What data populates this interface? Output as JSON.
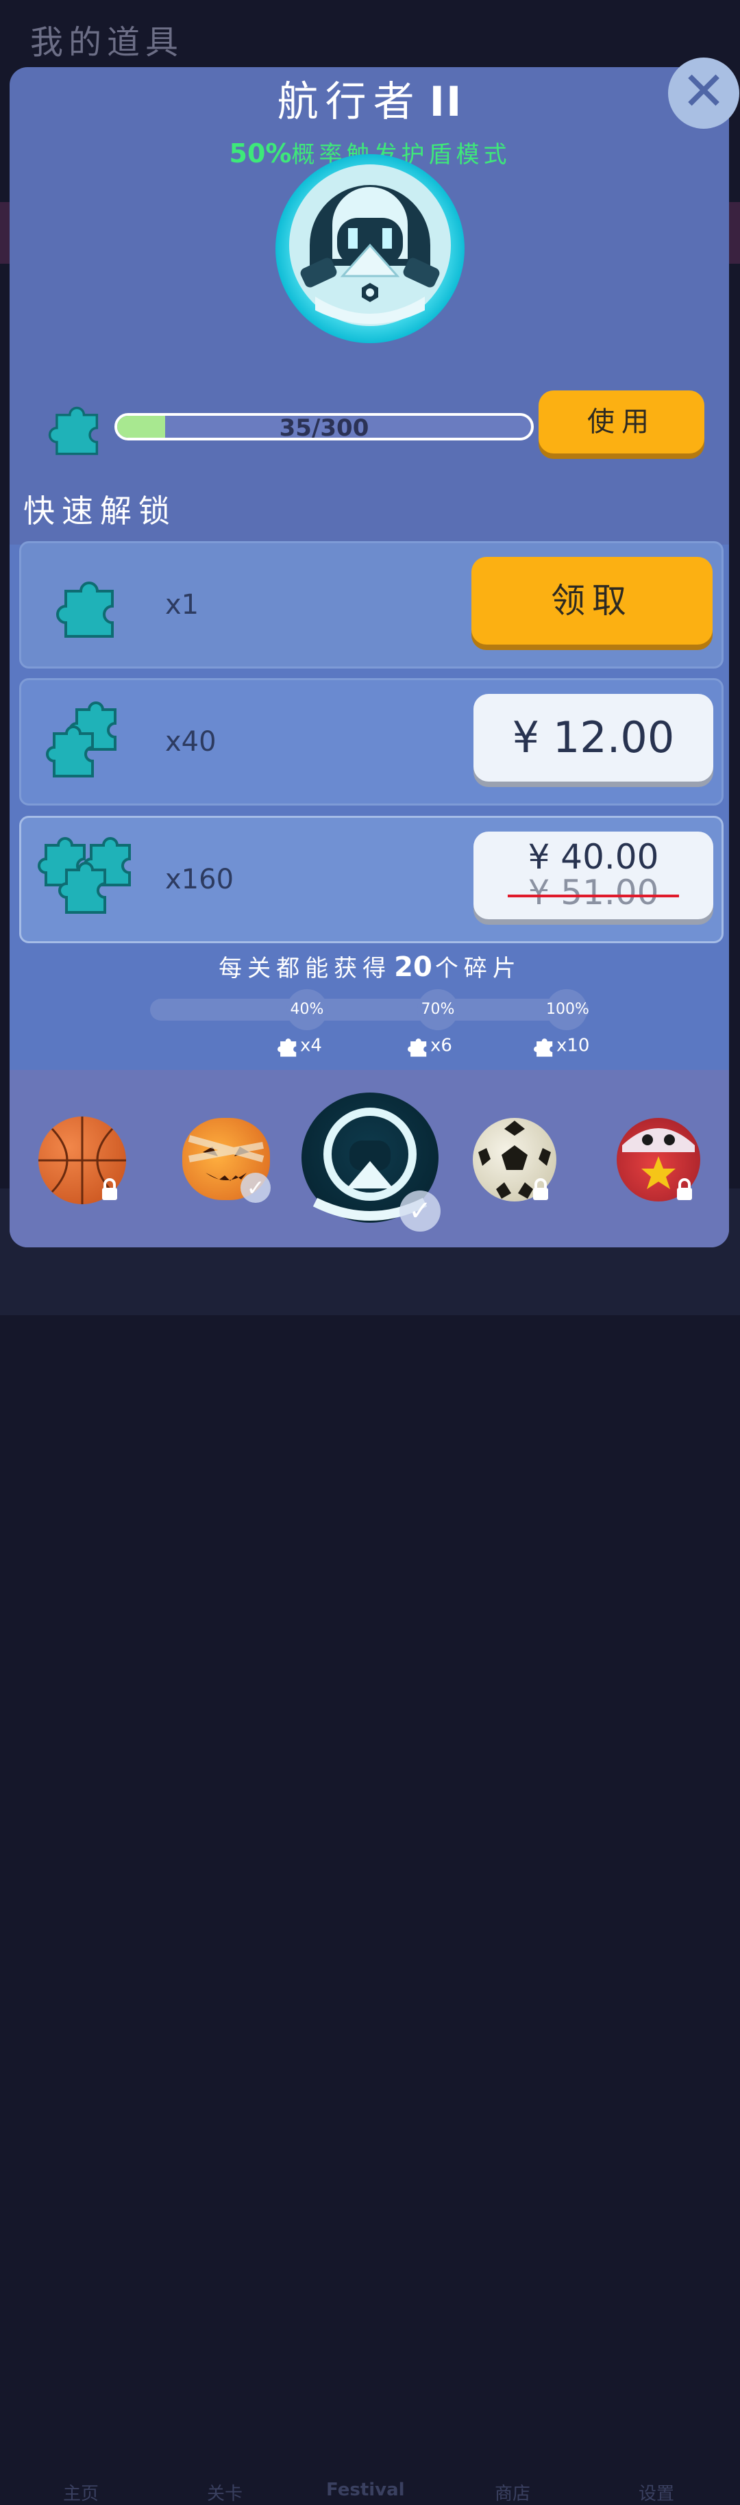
{
  "background": {
    "screen_title": "我的道具",
    "nav": [
      "主页",
      "关卡",
      "Festival",
      "商店",
      "设置"
    ]
  },
  "modal": {
    "title": "航行者",
    "title_suffix": "II",
    "subtitle_percent": "50%",
    "subtitle_text": "概率触发护盾模式",
    "close_icon": "close-icon",
    "progress": {
      "text": "35/300",
      "current": 35,
      "max": 300
    },
    "use_button": "使用",
    "quick_unlock_label": "快速解锁",
    "offers": [
      {
        "qty": "x1",
        "action": "领取",
        "icon": "puzzle-piece-icon"
      },
      {
        "qty": "x40",
        "price": "¥ 12.00",
        "icon": "puzzle-stack-icon"
      },
      {
        "qty": "x160",
        "price": "¥ 40.00",
        "original_price": "¥ 51.00",
        "icon": "puzzle-pile-icon"
      }
    ],
    "info": {
      "prefix": "每关都能获得",
      "amount": "20",
      "suffix": "个碎片"
    },
    "milestones": [
      {
        "label": "40%",
        "reward": "x4"
      },
      {
        "label": "70%",
        "reward": "x6"
      },
      {
        "label": "100%",
        "reward": "x10"
      }
    ],
    "skins": [
      {
        "name": "basketball",
        "state": "locked"
      },
      {
        "name": "pumpkin",
        "state": "owned"
      },
      {
        "name": "voyager",
        "state": "selected"
      },
      {
        "name": "soccer",
        "state": "locked"
      },
      {
        "name": "clown",
        "state": "locked"
      }
    ],
    "colors": {
      "accent": "#fcb012",
      "green": "#3ee87a",
      "panel": "#5b78c2"
    }
  }
}
